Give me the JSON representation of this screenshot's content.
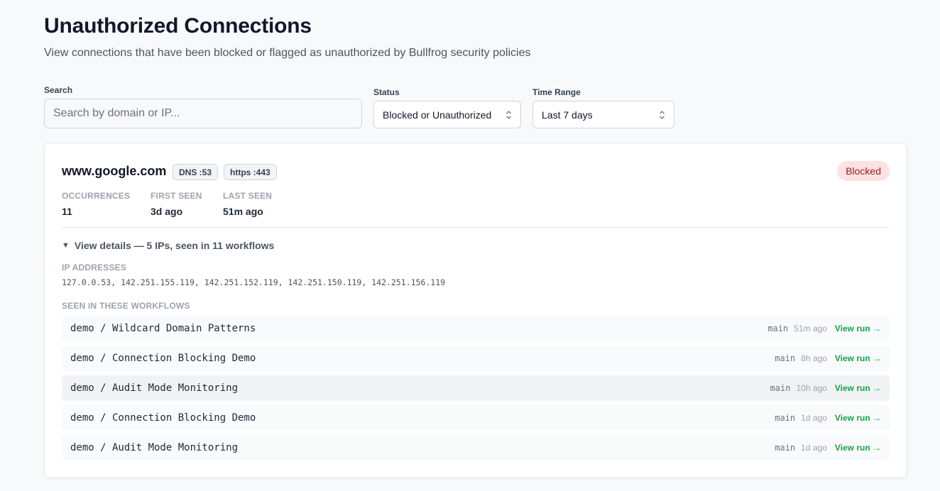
{
  "header": {
    "title": "Unauthorized Connections",
    "subtitle": "View connections that have been blocked or flagged as unauthorized by Bullfrog security policies"
  },
  "filters": {
    "search_label": "Search",
    "search_placeholder": "Search by domain or IP...",
    "search_value": "",
    "status_label": "Status",
    "status_value": "Blocked or Unauthorized",
    "time_label": "Time Range",
    "time_value": "Last 7 days"
  },
  "connection": {
    "domain": "www.google.com",
    "ports": [
      "DNS :53",
      "https :443"
    ],
    "status": "Blocked",
    "stats": {
      "occurrences_label": "OCCURRENCES",
      "occurrences_value": "11",
      "first_seen_label": "FIRST SEEN",
      "first_seen_value": "3d ago",
      "last_seen_label": "LAST SEEN",
      "last_seen_value": "51m ago"
    },
    "details_toggle": "View details — 5 IPs, seen in 11 workflows",
    "ip_label": "IP ADDRESSES",
    "ip_addresses": "127.0.0.53, 142.251.155.119, 142.251.152.119, 142.251.150.119, 142.251.156.119",
    "workflows_label": "SEEN IN THESE WORKFLOWS",
    "workflows": [
      {
        "name": "demo / Wildcard Domain Patterns",
        "branch": "main",
        "time": "51m ago",
        "link": "View run →"
      },
      {
        "name": "demo / Connection Blocking Demo",
        "branch": "main",
        "time": "8h ago",
        "link": "View run →"
      },
      {
        "name": "demo / Audit Mode Monitoring",
        "branch": "main",
        "time": "10h ago",
        "link": "View run →"
      },
      {
        "name": "demo / Connection Blocking Demo",
        "branch": "main",
        "time": "1d ago",
        "link": "View run →"
      },
      {
        "name": "demo / Audit Mode Monitoring",
        "branch": "main",
        "time": "1d ago",
        "link": "View run →"
      }
    ]
  },
  "colors": {
    "background": "#f8f9fb",
    "blocked_badge_bg": "#fde2e2",
    "blocked_badge_text": "#991b1b",
    "link_green": "#16a34a"
  }
}
